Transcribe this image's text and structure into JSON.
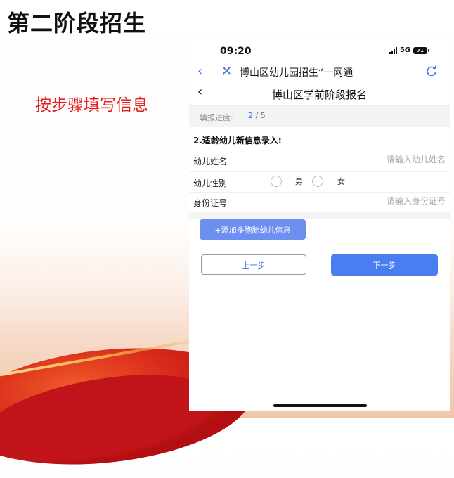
{
  "slide": {
    "title": "第二阶段招生",
    "note": "按步骤填写信息"
  },
  "status_bar": {
    "time": "09:20",
    "network": "5G",
    "battery": "71"
  },
  "browser": {
    "title": "博山区幼儿园招生“一网通"
  },
  "page": {
    "title": "博山区学前阶段报名"
  },
  "progress": {
    "label": "填报进度:",
    "current": "2",
    "separator": "/",
    "total": "5"
  },
  "form": {
    "section_title": "2.适龄幼儿新信息录入:",
    "name_label": "幼儿姓名",
    "name_placeholder": "请输入幼儿姓名",
    "name_value": "",
    "gender_label": "幼儿性别",
    "gender_options": [
      "男",
      "女"
    ],
    "id_label": "身份证号",
    "id_placeholder": "请输入身份证号",
    "id_value": ""
  },
  "buttons": {
    "add_twins": "+添加多胞胎幼儿信息",
    "prev": "上一步",
    "next": "下一步"
  },
  "colors": {
    "accent": "#4a7ef0",
    "note_red": "#e21f1f"
  }
}
